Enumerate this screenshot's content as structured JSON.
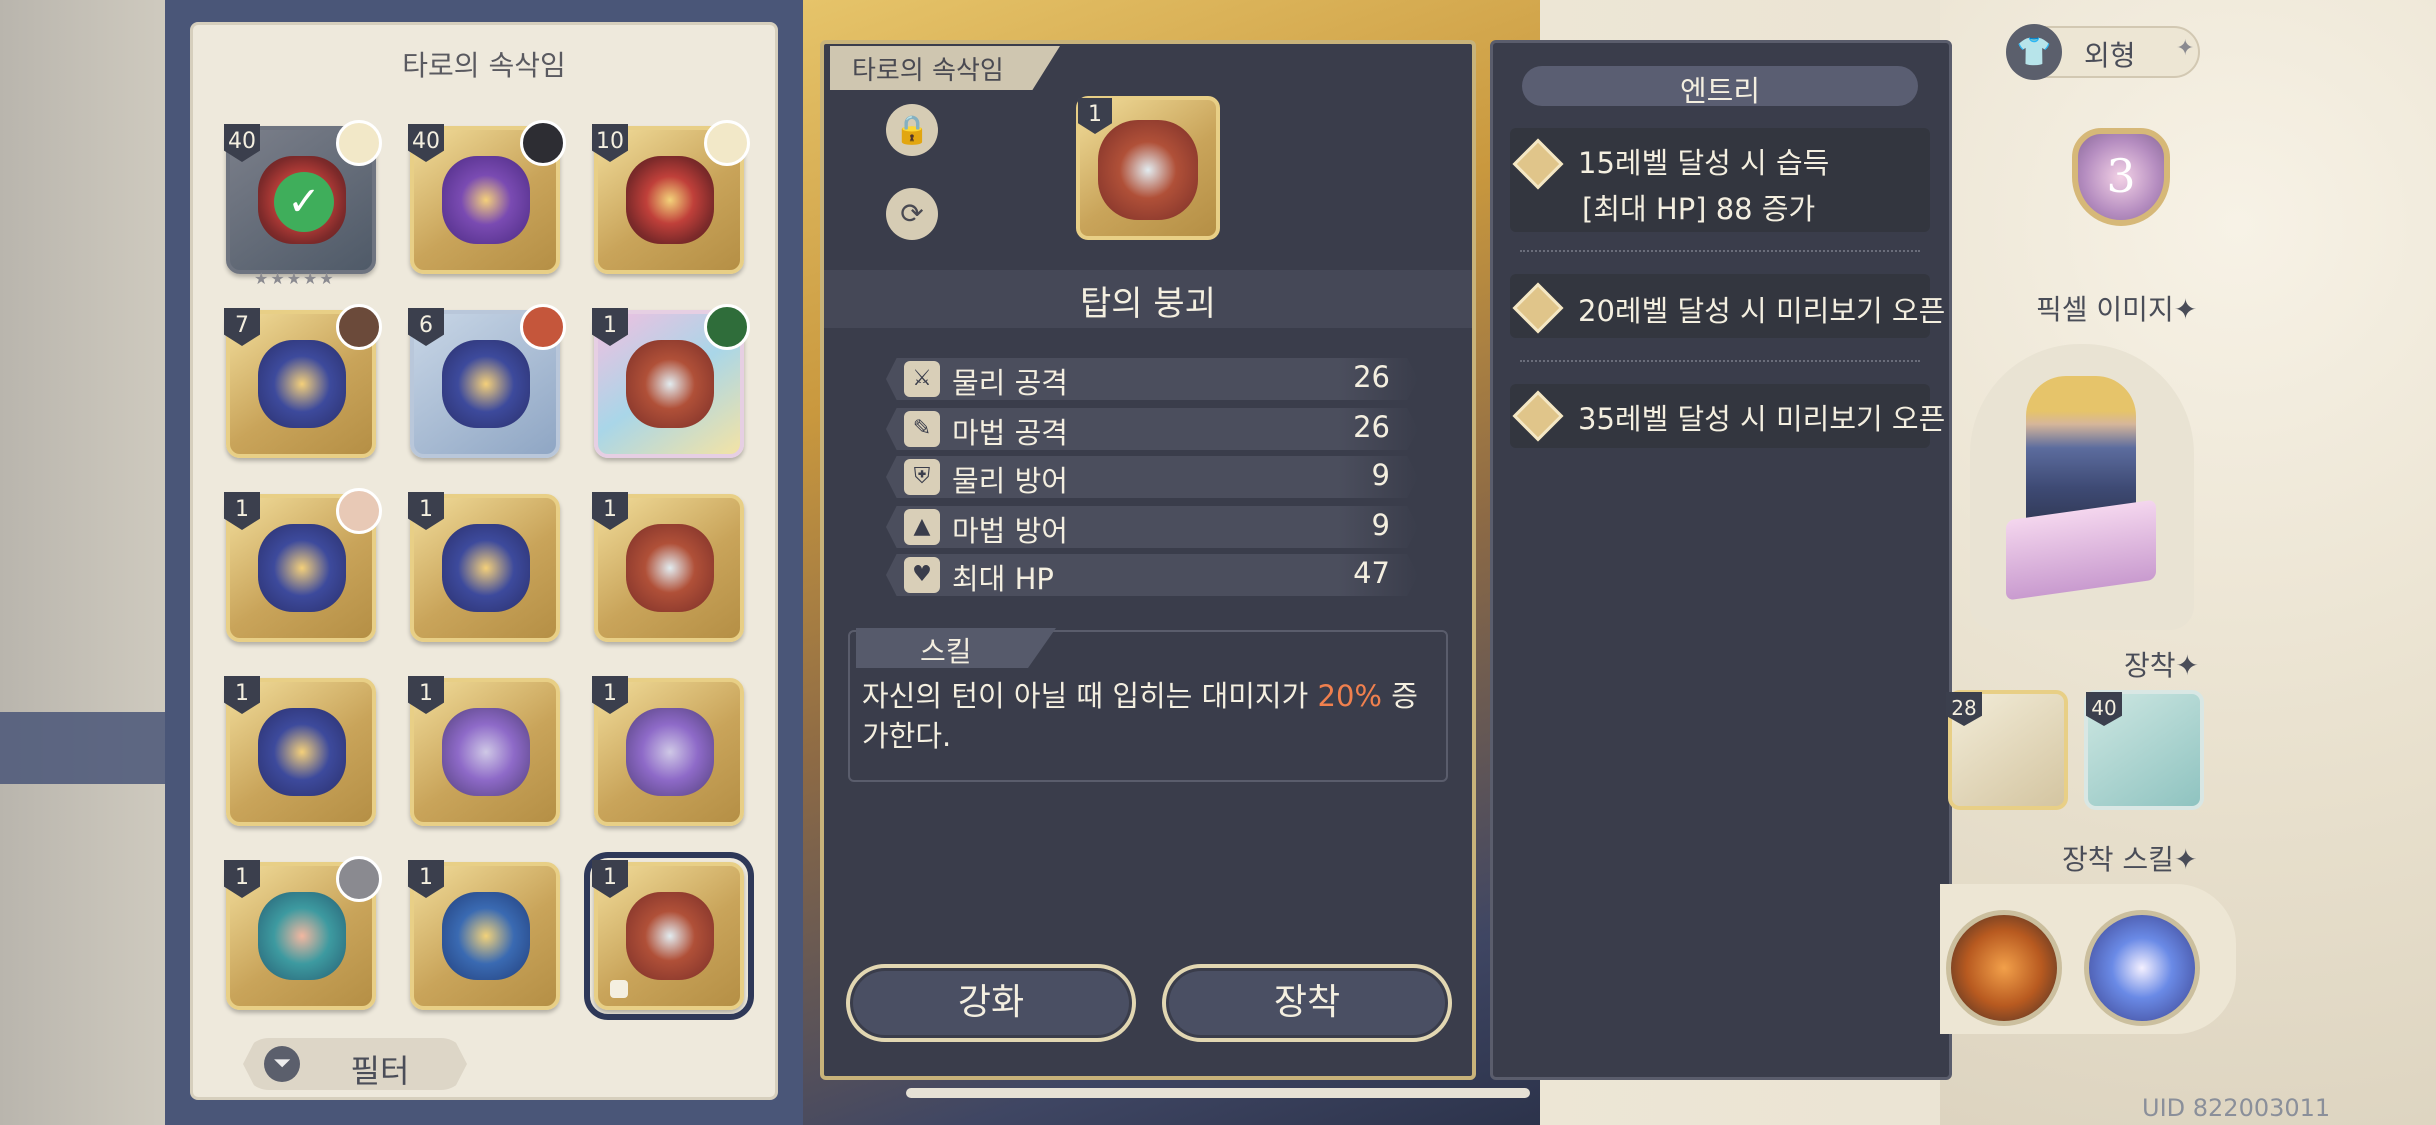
{
  "left_panel": {
    "title": "타로의 속삭임",
    "cards": [
      {
        "level": "40",
        "variant": "dark",
        "avatar": "blonde",
        "equipped": true
      },
      {
        "level": "40",
        "variant": "purple",
        "avatar": "dark"
      },
      {
        "level": "10",
        "variant": "crown",
        "avatar": "blonde"
      },
      {
        "level": "7",
        "variant": "navy",
        "avatar": "brown"
      },
      {
        "level": "6",
        "variant": "blue",
        "avatar": "red"
      },
      {
        "level": "1",
        "variant": "rainbow",
        "avatar": "green"
      },
      {
        "level": "1",
        "variant": "navy",
        "avatar": "pale"
      },
      {
        "level": "1",
        "variant": "navy-gold"
      },
      {
        "level": "1",
        "variant": "tower"
      },
      {
        "level": "1",
        "variant": "navy-gold"
      },
      {
        "level": "1",
        "variant": "bat"
      },
      {
        "level": "1",
        "variant": "bat"
      },
      {
        "level": "1",
        "variant": "teal",
        "avatar": "grey"
      },
      {
        "level": "1",
        "variant": "scale"
      },
      {
        "level": "1",
        "variant": "tower",
        "selected": true,
        "locked": true
      }
    ],
    "filter_label": "필터"
  },
  "detail": {
    "tab_label": "타로의 속삭임",
    "item_level": "1",
    "item_name": "탑의 붕괴",
    "stats": [
      {
        "icon": "sword-icon",
        "label": "물리 공격",
        "value": "26"
      },
      {
        "icon": "wand-icon",
        "label": "마법 공격",
        "value": "26"
      },
      {
        "icon": "shield-icon",
        "label": "물리 방어",
        "value": "9"
      },
      {
        "icon": "hat-icon",
        "label": "마법 방어",
        "value": "9"
      },
      {
        "icon": "heart-icon",
        "label": "최대 HP",
        "value": "47"
      }
    ],
    "skill_tab": "스킬",
    "skill_desc_before": "자신의 턴이 아닐 때 입히는 대미지가 ",
    "skill_desc_highlight": "20%",
    "skill_desc_after": " 증가한다.",
    "enhance_label": "강화",
    "equip_label": "장착"
  },
  "entry": {
    "title": "엔트리",
    "rows": [
      {
        "line1": "15레벨 달성 시 습득",
        "line2": "[최대 HP] 88 증가"
      },
      {
        "line1": "20레벨 달성 시 미리보기 오픈"
      },
      {
        "line1": "35레벨 달성 시 미리보기 오픈"
      }
    ]
  },
  "right": {
    "appearance_label": "외형",
    "heart_number": "3",
    "pixel_image_label": "픽셀 이미지",
    "equip_label": "장착",
    "equip_char_level": "28",
    "equip_item_level": "40",
    "equip_skill_label": "장착 스킬",
    "uid": "UID 822003011"
  },
  "colors": {
    "panel_dark": "#3a3d4b",
    "frame_blue": "#4a5678",
    "gold": "#c8b37a",
    "highlight": "#f0804e"
  }
}
